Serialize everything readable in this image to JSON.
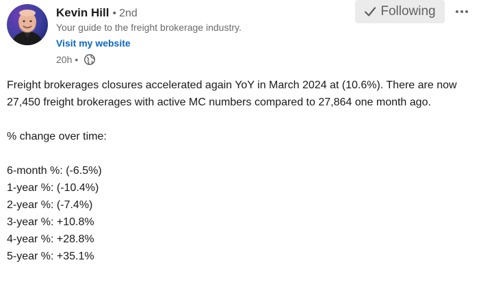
{
  "post": {
    "actor": {
      "name": "Kevin Hill",
      "bullet": "•",
      "degree": "2nd",
      "headline": "Your guide to the freight brokerage industry.",
      "website_label": "Visit my website",
      "timestamp": "20h",
      "meta_separator": "•",
      "visibility_icon": "globe-icon"
    },
    "controls": {
      "follow_label": "Following",
      "follow_icon": "check-icon",
      "more_icon": "ellipsis-icon"
    },
    "body": {
      "intro": "Freight brokerages closures accelerated again YoY in March 2024 at (10.6%). There are now 27,450 freight brokerages with active MC numbers compared to 27,864 one month ago.",
      "section_heading": "% change over time:",
      "stats": [
        "6-month %: (-6.5%)",
        "1-year %: (-10.4%)",
        "2-year %: (-7.4%)",
        "3-year %: +10.8%",
        "4-year %: +28.8%",
        "5-year %: +35.1%"
      ]
    }
  },
  "colors": {
    "link": "#0a66c2",
    "follow_bg": "#ebebeb",
    "avatar_bg": "#3b3f9e"
  }
}
